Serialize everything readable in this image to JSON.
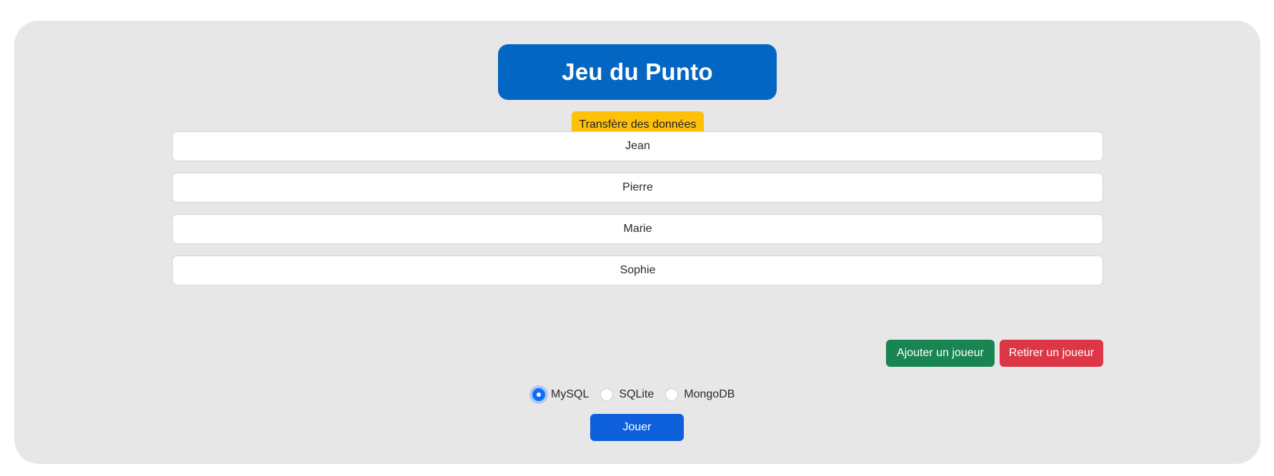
{
  "header": {
    "title": "Jeu du Punto"
  },
  "transfer": {
    "label": "Transfère des données"
  },
  "players": [
    {
      "value": "Jean"
    },
    {
      "value": "Pierre"
    },
    {
      "value": "Marie"
    },
    {
      "value": "Sophie"
    }
  ],
  "actions": {
    "add_label": "Ajouter un joueur",
    "remove_label": "Retirer un joueur"
  },
  "database": {
    "selected": "MySQL",
    "options": [
      {
        "label": "MySQL"
      },
      {
        "label": "SQLite"
      },
      {
        "label": "MongoDB"
      }
    ]
  },
  "play": {
    "label": "Jouer"
  },
  "colors": {
    "title_bg": "#0366c3",
    "transfer_bg": "#fdc10a",
    "add_bg": "#198553",
    "remove_bg": "#dd3646",
    "play_bg": "#0d5fdc",
    "panel_bg": "#e7e7e7"
  }
}
